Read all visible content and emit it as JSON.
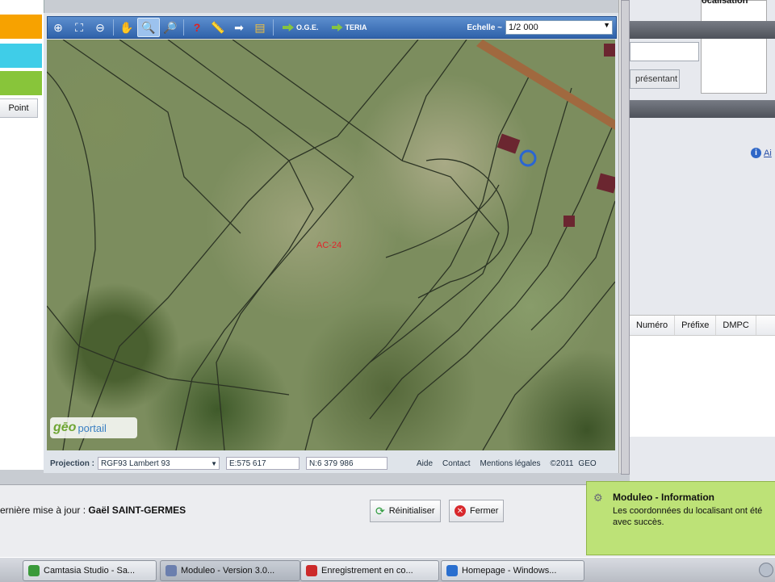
{
  "left_panel": {
    "color_bars": [
      "#f7a200",
      "#3fcde8",
      "#88c53a"
    ],
    "point_button": "Point"
  },
  "map_toolbar": {
    "icons": [
      "zoom-in-rect-icon",
      "full-extent-icon",
      "zoom-out-rect-icon",
      "pan-hand-icon",
      "zoom-in-icon",
      "zoom-out-icon",
      "help-icon",
      "measure-icon",
      "export-icon",
      "layers-icon"
    ],
    "oge_label": "O.G.E.",
    "teria_label": "TERIA",
    "echelle_label": "Echelle ~",
    "echelle_value": "1/2 000"
  },
  "map": {
    "parcel_label": "AC-24",
    "logo_ge": "gēo",
    "logo_portail": "portail"
  },
  "map_status": {
    "projection_label": "Projection :",
    "projection_value": "RGF93 Lambert 93",
    "east": "E:575 617",
    "north": "N:6 379 986",
    "aide": "Aide",
    "contact": "Contact",
    "mentions": "Mentions légales",
    "copyright": "©2011",
    "copyright_tail": "GEO"
  },
  "right_panel": {
    "top_text": "ocalisation",
    "button_label": "présentant",
    "info_text": "Ai",
    "table_headers": [
      "Numéro",
      "Préfixe",
      "DMPC"
    ]
  },
  "bottom_bar": {
    "update_prefix": "ernière mise à jour :",
    "update_user": "Gaël SAINT-GERMES",
    "reset_button": "Réinitialiser",
    "close_button": "Fermer"
  },
  "notification": {
    "title": "Moduleo - Information",
    "line1": "Les coordonnées du localisant ont été",
    "line2": "avec succès."
  },
  "taskbar": {
    "items": [
      {
        "label": "Camtasia Studio - Sa...",
        "color": "#3a9a3a"
      },
      {
        "label": "Moduleo - Version 3.0...",
        "color": "#6b7fae"
      },
      {
        "label": "Enregistrement en co...",
        "color": "#cc2a2a"
      },
      {
        "label": "Homepage - Windows...",
        "color": "#2a6fcf"
      }
    ]
  }
}
